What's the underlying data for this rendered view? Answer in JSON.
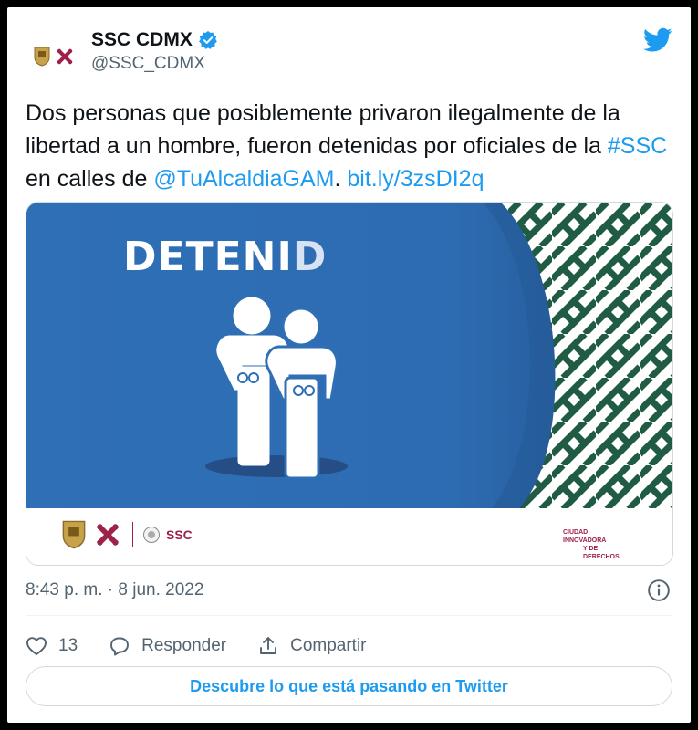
{
  "author": {
    "name": "SSC CDMX",
    "handle": "@SSC_CDMX",
    "verified": true
  },
  "tweet": {
    "text_parts": [
      {
        "text": "Dos personas que posiblemente privaron ilegalmente de la libertad a un hombre, fueron detenidas por oficiales de la ",
        "link": false
      },
      {
        "text": "#SSC",
        "link": true
      },
      {
        "text": " en calles de ",
        "link": false
      },
      {
        "text": "@TuAlcaldiaGAM",
        "link": true
      },
      {
        "text": ". ",
        "link": false
      },
      {
        "text": "bit.ly/3zsDI2q",
        "link": true
      }
    ],
    "timestamp": "8:43 p. m. · 8 jun. 2022"
  },
  "media": {
    "headline": "DETENID",
    "headline_last": "D",
    "footer_ssc": "SSC",
    "city_tag_line1": "CIUDAD INNOVADORA",
    "city_tag_line2": "Y DE DERECHOS"
  },
  "actions": {
    "like_count": "13",
    "reply_label": "Responder",
    "share_label": "Compartir"
  },
  "cta": {
    "label": "Descubre lo que está pasando en Twitter"
  },
  "colors": {
    "twitter_blue": "#1d9bf0",
    "media_blue": "#2f6fb6",
    "pattern_green": "#1f5c43",
    "brand_maroon": "#9d2148"
  }
}
